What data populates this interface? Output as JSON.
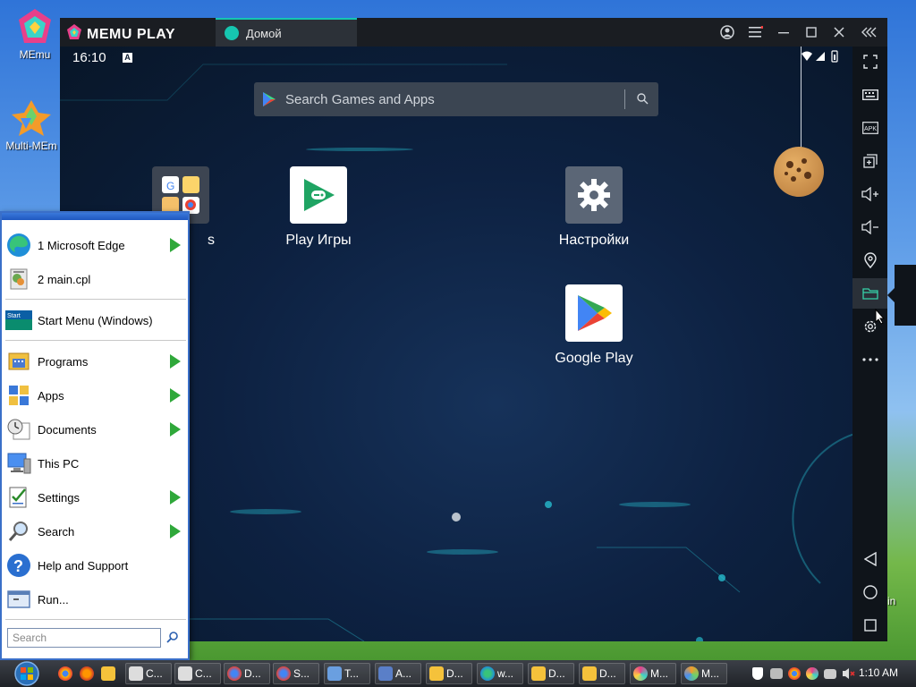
{
  "desktop": {
    "icons": [
      {
        "label": "MEmu"
      },
      {
        "label": "Multi-MEm"
      }
    ],
    "partial_label": "in"
  },
  "memu": {
    "brand": "MEMU PLAY",
    "tab_label": "Домой",
    "status_time": "16:10",
    "status_badge": "A",
    "search_placeholder": "Search Games and Apps",
    "apps": [
      {
        "label": "s"
      },
      {
        "label": "Play Игры"
      },
      {
        "label": "Настройки"
      },
      {
        "label": "Google Play"
      }
    ],
    "sidebar": [
      "fullscreen-icon",
      "keyboard-icon",
      "apk-icon",
      "add-window-icon",
      "volume-up-icon",
      "volume-down-icon",
      "location-icon",
      "folder-icon",
      "settings-icon",
      "more-icon",
      "back-icon",
      "home-icon",
      "recents-icon"
    ]
  },
  "start_menu": {
    "items": [
      {
        "label": "1 Microsoft Edge",
        "arrow": true
      },
      {
        "label": "2 main.cpl",
        "arrow": false
      },
      {
        "label": "Start Menu (Windows)",
        "arrow": false
      },
      {
        "label": "Programs",
        "arrow": true
      },
      {
        "label": "Apps",
        "arrow": true
      },
      {
        "label": "Documents",
        "arrow": true
      },
      {
        "label": "This PC",
        "arrow": false
      },
      {
        "label": "Settings",
        "arrow": true
      },
      {
        "label": "Search",
        "arrow": true
      },
      {
        "label": "Help and Support",
        "arrow": false
      },
      {
        "label": "Run...",
        "arrow": false
      }
    ],
    "search_placeholder": "Search"
  },
  "taskbar": {
    "buttons": [
      {
        "label": "C..."
      },
      {
        "label": "C..."
      },
      {
        "label": "D..."
      },
      {
        "label": "S..."
      },
      {
        "label": "T..."
      },
      {
        "label": "A..."
      },
      {
        "label": "D..."
      },
      {
        "label": "w..."
      },
      {
        "label": "D..."
      },
      {
        "label": "D..."
      },
      {
        "label": "M..."
      },
      {
        "label": "M..."
      }
    ],
    "clock": "1:10 AM"
  },
  "colors": {
    "accent": "#16c6b0",
    "arrow_green": "#2fa83a",
    "start_border": "#3a6fc8"
  }
}
